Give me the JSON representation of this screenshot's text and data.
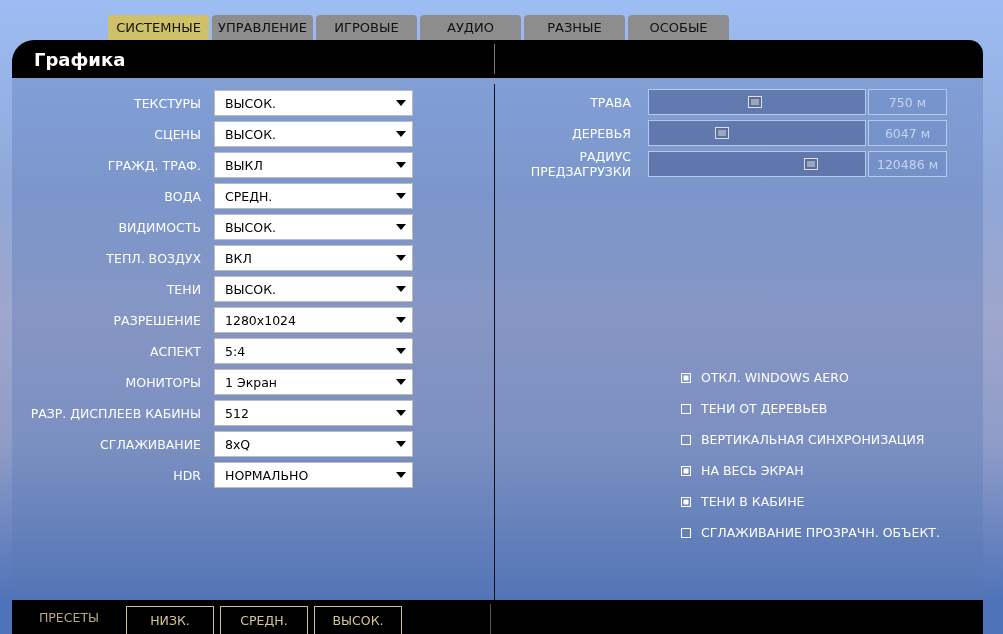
{
  "tabs": [
    {
      "label": "СИСТЕМНЫЕ",
      "selected": true
    },
    {
      "label": "УПРАВЛЕНИЕ",
      "selected": false
    },
    {
      "label": "ИГРОВЫЕ",
      "selected": false
    },
    {
      "label": "АУДИО",
      "selected": false
    },
    {
      "label": "РАЗНЫЕ",
      "selected": false
    },
    {
      "label": "ОСОБЫЕ",
      "selected": false
    }
  ],
  "panel": {
    "title": "Графика"
  },
  "settings": [
    {
      "label": "ТЕКСТУРЫ",
      "value": "ВЫСОК."
    },
    {
      "label": "СЦЕНЫ",
      "value": "ВЫСОК."
    },
    {
      "label": "ГРАЖД. ТРАФ.",
      "value": "ВЫКЛ"
    },
    {
      "label": "ВОДА",
      "value": "СРЕДН."
    },
    {
      "label": "ВИДИМОСТЬ",
      "value": "ВЫСОК."
    },
    {
      "label": "ТЕПЛ. ВОЗДУХ",
      "value": "ВКЛ"
    },
    {
      "label": "ТЕНИ",
      "value": "ВЫСОК."
    },
    {
      "label": "РАЗРЕШЕНИЕ",
      "value": "1280x1024"
    },
    {
      "label": "АСПЕКТ",
      "value": "5:4"
    },
    {
      "label": "МОНИТОРЫ",
      "value": "1 Экран"
    },
    {
      "label": "РАЗР. ДИСПЛЕЕВ КАБИНЫ",
      "value": "512"
    },
    {
      "label": "СГЛАЖИВАНИЕ",
      "value": "8xQ"
    },
    {
      "label": "HDR",
      "value": "НОРМАЛЬНО"
    }
  ],
  "sliders": [
    {
      "label": "ТРАВА",
      "level": 0.49,
      "reading": "750 м"
    },
    {
      "label": "ДЕРЕВЬЯ",
      "level": 0.34,
      "reading": "6047 м"
    },
    {
      "label": "РАДИУС ПРЕДЗАГРУЗКИ",
      "level": 0.75,
      "reading": "120486 м"
    }
  ],
  "options": [
    {
      "label": "ОТКЛ. WINDOWS AERO",
      "checked": true
    },
    {
      "label": "ТЕНИ ОТ ДЕРЕВЬЕВ",
      "checked": false
    },
    {
      "label": "ВЕРТИКАЛЬНАЯ СИНХРОНИЗАЦИЯ",
      "checked": false
    },
    {
      "label": "НА ВЕСЬ ЭКРАН",
      "checked": true
    },
    {
      "label": "ТЕНИ В КАБИНЕ",
      "checked": true
    },
    {
      "label": "СГЛАЖИВАНИЕ ПРОЗРАЧН. ОБЪЕКТ.",
      "checked": false
    }
  ],
  "presets": {
    "label": "ПРЕСЕТЫ",
    "buttons": [
      "НИЗК.",
      "СРЕДН.",
      "ВЫСОК."
    ]
  }
}
